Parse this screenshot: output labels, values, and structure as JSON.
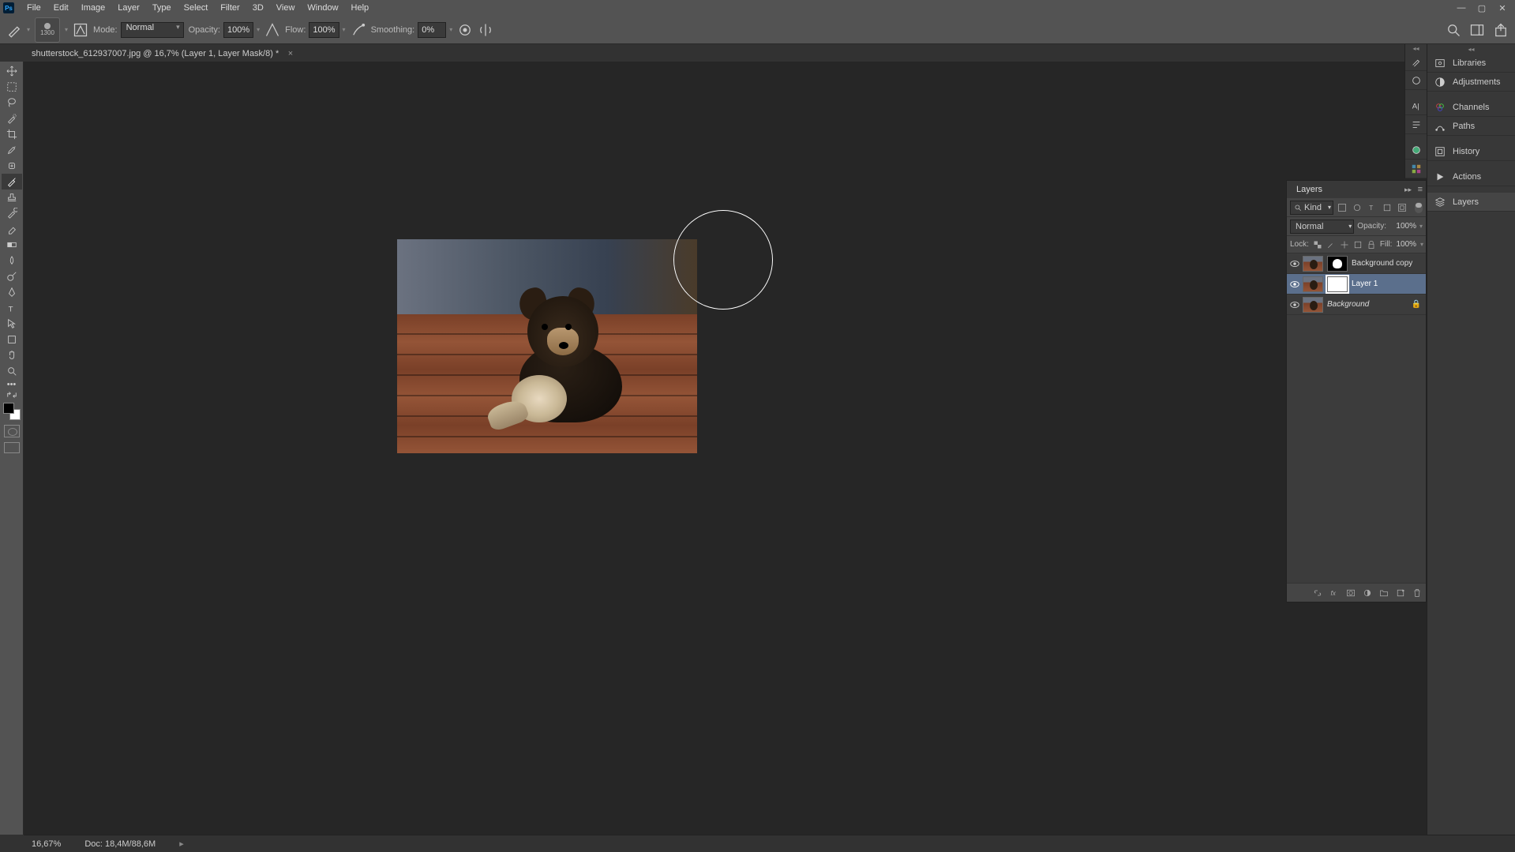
{
  "menu": [
    "File",
    "Edit",
    "Image",
    "Layer",
    "Type",
    "Select",
    "Filter",
    "3D",
    "View",
    "Window",
    "Help"
  ],
  "options": {
    "brush_size": "1300",
    "mode_label": "Mode:",
    "mode_value": "Normal",
    "opacity_label": "Opacity:",
    "opacity_value": "100%",
    "flow_label": "Flow:",
    "flow_value": "100%",
    "smoothing_label": "Smoothing:",
    "smoothing_value": "0%"
  },
  "doc_tab": "shutterstock_612937007.jpg @ 16,7% (Layer 1, Layer Mask/8) *",
  "right_dock": {
    "groups": [
      [
        "Libraries",
        "Adjustments"
      ],
      [
        "Channels",
        "Paths"
      ],
      [
        "History"
      ],
      [
        "Actions"
      ],
      [
        "Layers"
      ]
    ]
  },
  "layers_panel": {
    "tab": "Layers",
    "kind": "Kind",
    "blend": "Normal",
    "opacity_label": "Opacity:",
    "opacity_value": "100%",
    "lock_label": "Lock:",
    "fill_label": "Fill:",
    "fill_value": "100%",
    "layers": [
      {
        "name": "Background copy",
        "mask": "black",
        "selected": false,
        "locked": false
      },
      {
        "name": "Layer 1",
        "mask": "white",
        "selected": true,
        "locked": false
      },
      {
        "name": "Background",
        "mask": null,
        "selected": false,
        "locked": true,
        "italic": true
      }
    ]
  },
  "status": {
    "zoom": "16,67%",
    "doc": "Doc: 18,4M/88,6M"
  }
}
